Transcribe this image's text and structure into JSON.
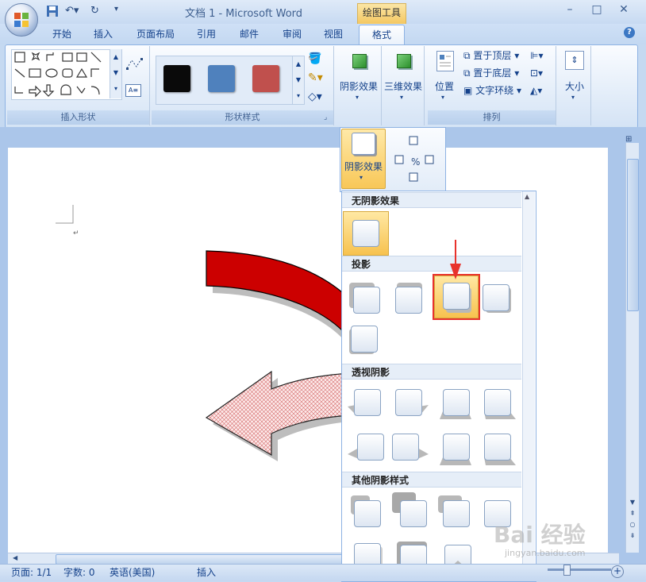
{
  "window": {
    "title": "文档 1 - Microsoft Word",
    "context_tab_title": "绘图工具",
    "minimize": "–",
    "maximize": "□",
    "close": "✕"
  },
  "tabs": [
    "开始",
    "插入",
    "页面布局",
    "引用",
    "邮件",
    "审阅",
    "视图"
  ],
  "active_tab": "格式",
  "ribbon": {
    "insert_shapes_label": "插入形状",
    "shape_styles_label": "形状样式",
    "arrange_label": "排列",
    "swatch_colors": [
      "#0a0a0a",
      "#4f81bd",
      "#c0504d"
    ],
    "shadow_effects": "阴影效果",
    "three_d_effects": "三维效果",
    "position": "位置",
    "bring_to_front": "置于顶层",
    "send_to_back": "置于底层",
    "text_wrap": "文字环绕",
    "size": "大小"
  },
  "shadow_menu": {
    "button_label": "阴影效果",
    "sections": {
      "no_shadow": "无阴影效果",
      "drop_shadow": "投影",
      "perspective": "透视阴影",
      "other": "其他阴影样式"
    }
  },
  "status": {
    "page": "页面: 1/1",
    "words": "字数: 0",
    "language": "英语(美国)",
    "mode": "插入"
  },
  "watermark": {
    "text": "Bai 经验",
    "sub": "jingyan.baidu.com"
  },
  "colors": {
    "accent": "#f8c757",
    "highlight": "#e8322c",
    "arrow_red": "#cc0000"
  }
}
